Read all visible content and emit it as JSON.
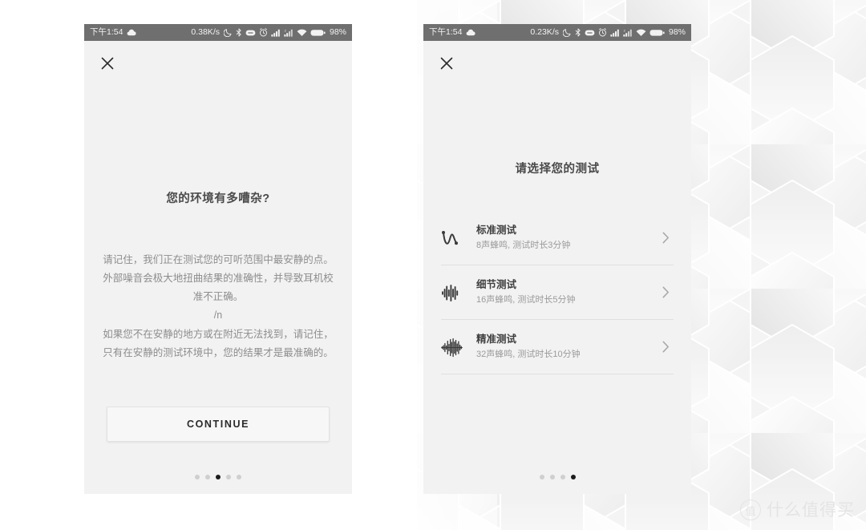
{
  "background": {
    "pattern": "hexagon-tile-wall",
    "base_color": "#ffffff",
    "hex_light": "#fbfbfb",
    "hex_mid": "#f1f1f1",
    "hex_dark": "#e3e3e3"
  },
  "watermark": {
    "badge_glyph": "值",
    "text": "什么值得买"
  },
  "left_phone": {
    "status_bar": {
      "time": "下午1:54",
      "weather_icon": "cloud-icon",
      "network_speed": "0.38K/s",
      "icons": [
        "moon-icon",
        "bluetooth-icon",
        "do-not-disturb-icon",
        "alarm-icon",
        "signal-sim1-icon",
        "signal-sim2-icon",
        "wifi-icon",
        "battery-icon"
      ],
      "battery_percent": "98%"
    },
    "close_icon": "close-icon",
    "title": "您的环境有多嘈杂?",
    "body_paragraph_1": "请记住，我们正在测试您的可听范围中最安静的点。外部噪音会极大地扭曲结果的准确性，并导致耳机校准不正确。",
    "body_separator": "/n",
    "body_paragraph_2": "如果您不在安静的地方或在附近无法找到，请记住，只有在安静的测试环境中，您的结果才是最准确的。",
    "continue_label": "CONTINUE",
    "page_dots": {
      "count": 5,
      "active_index": 2
    }
  },
  "right_phone": {
    "status_bar": {
      "time": "下午1:54",
      "weather_icon": "cloud-icon",
      "network_speed": "0.23K/s",
      "icons": [
        "moon-icon",
        "bluetooth-icon",
        "do-not-disturb-icon",
        "alarm-icon",
        "signal-sim1-icon",
        "signal-sim2-icon",
        "wifi-icon",
        "battery-icon"
      ],
      "battery_percent": "98%"
    },
    "close_icon": "close-icon",
    "title": "请选择您的测试",
    "tests": [
      {
        "icon": "waveform-sparse-icon",
        "name": "标准测试",
        "description": "8声蜂鸣, 测试时长3分钟",
        "chevron": "chevron-right-icon"
      },
      {
        "icon": "waveform-medium-icon",
        "name": "细节测试",
        "description": "16声蜂鸣, 测试时长5分钟",
        "chevron": "chevron-right-icon"
      },
      {
        "icon": "waveform-dense-icon",
        "name": "精准测试",
        "description": "32声蜂鸣, 测试时长10分钟",
        "chevron": "chevron-right-icon"
      }
    ],
    "page_dots": {
      "count": 4,
      "active_index": 3
    }
  }
}
